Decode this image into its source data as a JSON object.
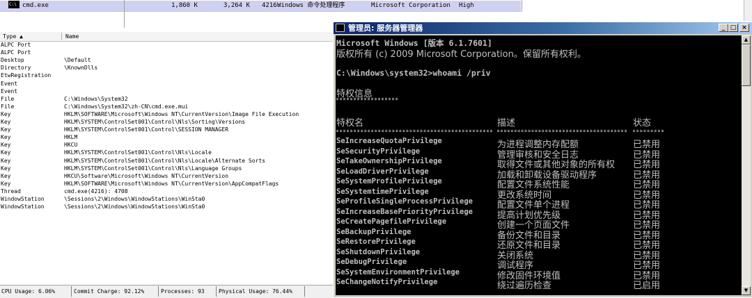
{
  "process_row": {
    "icon_text": "C:\\",
    "name": "cmd.exe",
    "private_bytes": "1,860 K",
    "working_set": "3,264 K",
    "pid": "4216",
    "description": "Windows 命令处理程序",
    "company": "Microsoft Corporation",
    "integrity": "High"
  },
  "handles": {
    "col_type": "Type  ▲",
    "col_name": "Name",
    "rows": [
      {
        "type": "ALPC Port",
        "name": ""
      },
      {
        "type": "ALPC Port",
        "name": ""
      },
      {
        "type": "Desktop",
        "name": "\\Default"
      },
      {
        "type": "Directory",
        "name": "\\KnownDlls"
      },
      {
        "type": "EtwRegistration",
        "name": ""
      },
      {
        "type": "Event",
        "name": ""
      },
      {
        "type": "Event",
        "name": ""
      },
      {
        "type": "File",
        "name": "C:\\Windows\\System32"
      },
      {
        "type": "File",
        "name": "C:\\Windows\\System32\\zh-CN\\cmd.exe.mui"
      },
      {
        "type": "Key",
        "name": "HKLM\\SOFTWARE\\Microsoft\\Windows NT\\CurrentVersion\\Image File Execution"
      },
      {
        "type": "Key",
        "name": "HKLM\\SYSTEM\\ControlSet001\\Control\\Nls\\Sorting\\Versions"
      },
      {
        "type": "Key",
        "name": "HKLM\\SYSTEM\\ControlSet001\\Control\\SESSION MANAGER"
      },
      {
        "type": "Key",
        "name": "HKLM"
      },
      {
        "type": "Key",
        "name": "HKCU"
      },
      {
        "type": "Key",
        "name": "HKLM\\SYSTEM\\ControlSet001\\Control\\Nls\\Locale"
      },
      {
        "type": "Key",
        "name": "HKLM\\SYSTEM\\ControlSet001\\Control\\Nls\\Locale\\Alternate Sorts"
      },
      {
        "type": "Key",
        "name": "HKLM\\SYSTEM\\ControlSet001\\Control\\Nls\\Language Groups"
      },
      {
        "type": "Key",
        "name": "HKCU\\Software\\Microsoft\\Windows NT\\CurrentVersion"
      },
      {
        "type": "Key",
        "name": "HKLM\\SOFTWARE\\Microsoft\\Windows NT\\CurrentVersion\\AppCompatFlags"
      },
      {
        "type": "Thread",
        "name": "cmd.exe(4216): 4708"
      },
      {
        "type": "WindowStation",
        "name": "\\Sessions\\2\\Windows\\WindowStations\\WinSta0"
      },
      {
        "type": "WindowStation",
        "name": "\\Sessions\\2\\Windows\\WindowStations\\WinSta0"
      }
    ]
  },
  "statusbar": {
    "cpu": "CPU Usage: 6.06%",
    "commit": "Commit Charge: 92.12%",
    "processes": "Processes: 93",
    "physical": "Physical Usage: 76.44%"
  },
  "cmd_window": {
    "title": "管理员: 服务器管理器",
    "minimize": "_",
    "maximize": "□",
    "close": "×",
    "scroll_up": "▲",
    "scroll_down": "▼",
    "lines": {
      "version": "Microsoft Windows [版本 6.1.7601]",
      "copyright": "版权所有 (c) 2009 Microsoft Corporation。保留所有权利。",
      "prompt": "C:\\Windows\\system32>whoami /priv",
      "section": "特权信息",
      "col_name": "特权名",
      "col_desc": "描述",
      "col_state": "状态"
    },
    "privileges": [
      {
        "name": "SeIncreaseQuotaPrivilege",
        "desc": "为进程调整内存配额",
        "state": "已禁用"
      },
      {
        "name": "SeSecurityPrivilege",
        "desc": "管理审核和安全日志",
        "state": "已禁用"
      },
      {
        "name": "SeTakeOwnershipPrivilege",
        "desc": "取得文件或其他对象的所有权",
        "state": "已禁用"
      },
      {
        "name": "SeLoadDriverPrivilege",
        "desc": "加载和卸载设备驱动程序",
        "state": "已禁用"
      },
      {
        "name": "SeSystemProfilePrivilege",
        "desc": "配置文件系统性能",
        "state": "已禁用"
      },
      {
        "name": "SeSystemtimePrivilege",
        "desc": "更改系统时间",
        "state": "已禁用"
      },
      {
        "name": "SeProfileSingleProcessPrivilege",
        "desc": "配置文件单个进程",
        "state": "已禁用"
      },
      {
        "name": "SeIncreaseBasePriorityPrivilege",
        "desc": "提高计划优先级",
        "state": "已禁用"
      },
      {
        "name": "SeCreatePagefilePrivilege",
        "desc": "创建一个页面文件",
        "state": "已禁用"
      },
      {
        "name": "SeBackupPrivilege",
        "desc": "备份文件和目录",
        "state": "已禁用"
      },
      {
        "name": "SeRestorePrivilege",
        "desc": "还原文件和目录",
        "state": "已禁用"
      },
      {
        "name": "SeShutdownPrivilege",
        "desc": "关闭系统",
        "state": "已禁用"
      },
      {
        "name": "SeDebugPrivilege",
        "desc": "调试程序",
        "state": "已禁用"
      },
      {
        "name": "SeSystemEnvironmentPrivilege",
        "desc": "修改固件环境值",
        "state": "已禁用"
      },
      {
        "name": "SeChangeNotifyPrivilege",
        "desc": "绕过遍历检查",
        "state": "已启用"
      }
    ]
  }
}
